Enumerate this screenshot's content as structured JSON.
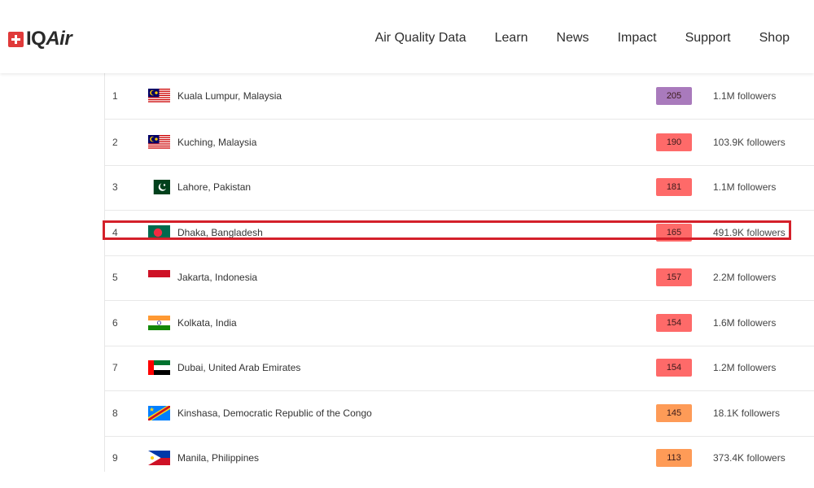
{
  "header": {
    "logo_prefix": "IQ",
    "logo_suffix": "Air",
    "nav": [
      "Air Quality Data",
      "Learn",
      "News",
      "Impact",
      "Support",
      "Shop"
    ]
  },
  "colors": {
    "purple": "#a97abc",
    "red": "#fe6a69",
    "orange": "#fe9b57",
    "highlight": "#d4202a"
  },
  "rows": [
    {
      "rank": "1",
      "city": "Kuala Lumpur, Malaysia",
      "aqi": "205",
      "followers": "1.1M followers",
      "flag": "malaysia-flag-icon",
      "color": "#a97abc"
    },
    {
      "rank": "2",
      "city": "Kuching, Malaysia",
      "aqi": "190",
      "followers": "103.9K followers",
      "flag": "malaysia-flag-icon",
      "color": "#fe6a69"
    },
    {
      "rank": "3",
      "city": "Lahore, Pakistan",
      "aqi": "181",
      "followers": "1.1M followers",
      "flag": "pakistan-flag-icon",
      "color": "#fe6a69"
    },
    {
      "rank": "4",
      "city": "Dhaka, Bangladesh",
      "aqi": "165",
      "followers": "491.9K followers",
      "flag": "bangladesh-flag-icon",
      "color": "#fe6a69"
    },
    {
      "rank": "5",
      "city": "Jakarta, Indonesia",
      "aqi": "157",
      "followers": "2.2M followers",
      "flag": "indonesia-flag-icon",
      "color": "#fe6a69"
    },
    {
      "rank": "6",
      "city": "Kolkata, India",
      "aqi": "154",
      "followers": "1.6M followers",
      "flag": "india-flag-icon",
      "color": "#fe6a69"
    },
    {
      "rank": "7",
      "city": "Dubai, United Arab Emirates",
      "aqi": "154",
      "followers": "1.2M followers",
      "flag": "uae-flag-icon",
      "color": "#fe6a69"
    },
    {
      "rank": "8",
      "city": "Kinshasa, Democratic Republic of the Congo",
      "aqi": "145",
      "followers": "18.1K followers",
      "flag": "drc-flag-icon",
      "color": "#fe9b57"
    },
    {
      "rank": "9",
      "city": "Manila, Philippines",
      "aqi": "113",
      "followers": "373.4K followers",
      "flag": "philippines-flag-icon",
      "color": "#fe9b57"
    }
  ]
}
